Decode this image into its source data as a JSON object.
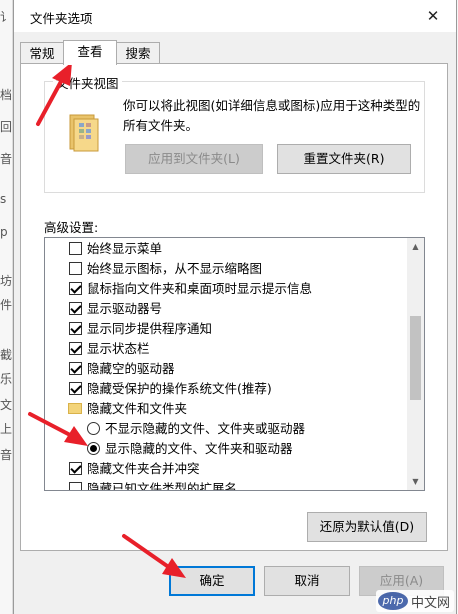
{
  "background_chars": [
    "讠",
    "档",
    "回",
    "音",
    "s",
    "p",
    "坊",
    "件",
    "截",
    "乐",
    "文",
    "上",
    "音"
  ],
  "dialog": {
    "title": "文件夹选项",
    "close_glyph": "✕"
  },
  "tabs": [
    {
      "label": "常规",
      "active": false
    },
    {
      "label": "查看",
      "active": true
    },
    {
      "label": "搜索",
      "active": false
    }
  ],
  "folder_views": {
    "group_title": "文件夹视图",
    "description": "你可以将此视图(如详细信息或图标)应用于这种类型的所有文件夹。",
    "apply_button": "应用到文件夹(L)",
    "reset_button": "重置文件夹(R)"
  },
  "advanced": {
    "label": "高级设置:",
    "items": [
      {
        "type": "checkbox",
        "checked": false,
        "label": "始终显示菜单"
      },
      {
        "type": "checkbox",
        "checked": false,
        "label": "始终显示图标，从不显示缩略图"
      },
      {
        "type": "checkbox",
        "checked": true,
        "label": "鼠标指向文件夹和桌面项时显示提示信息"
      },
      {
        "type": "checkbox",
        "checked": true,
        "label": "显示驱动器号"
      },
      {
        "type": "checkbox",
        "checked": true,
        "label": "显示同步提供程序通知"
      },
      {
        "type": "checkbox",
        "checked": true,
        "label": "显示状态栏"
      },
      {
        "type": "checkbox",
        "checked": true,
        "label": "隐藏空的驱动器"
      },
      {
        "type": "checkbox",
        "checked": true,
        "label": "隐藏受保护的操作系统文件(推荐)"
      },
      {
        "type": "folder",
        "label": "隐藏文件和文件夹"
      },
      {
        "type": "radio",
        "checked": false,
        "label": "不显示隐藏的文件、文件夹或驱动器"
      },
      {
        "type": "radio",
        "checked": true,
        "label": "显示隐藏的文件、文件夹和驱动器"
      },
      {
        "type": "checkbox",
        "checked": true,
        "label": "隐藏文件夹合并冲突"
      },
      {
        "type": "checkbox",
        "checked": false,
        "label": "隐藏已知文件类型的扩展名"
      }
    ],
    "restore_defaults": "还原为默认值(D)"
  },
  "footer": {
    "ok": "确定",
    "cancel": "取消",
    "apply": "应用(A)"
  },
  "watermark": {
    "logo_text": "php",
    "text": "中文网"
  },
  "colors": {
    "annotation_arrow": "#e8202a",
    "focus_border": "#0078d7"
  }
}
